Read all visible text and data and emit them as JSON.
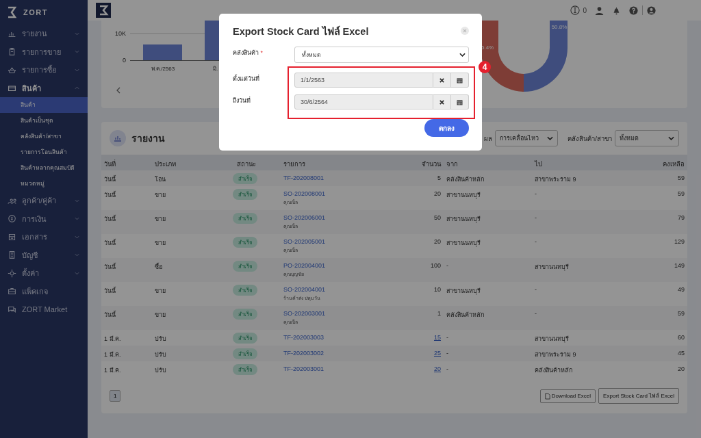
{
  "sidebar": {
    "brand": "ZORT",
    "items": [
      {
        "label": "รายงาน",
        "expanded": false
      },
      {
        "label": "รายการขาย",
        "expanded": false
      },
      {
        "label": "รายการซื้อ",
        "expanded": false
      },
      {
        "label": "สินค้า",
        "expanded": true,
        "children": [
          {
            "label": "สินค้า",
            "selected": true
          },
          {
            "label": "สินค้าเป็นชุด",
            "selected": false
          },
          {
            "label": "คลังสินค้า/สาขา",
            "selected": false
          },
          {
            "label": "รายการโอนสินค้า",
            "selected": false
          },
          {
            "label": "สินค้าหลากคุณสมบัติ",
            "selected": false
          },
          {
            "label": "หมวดหมู่",
            "selected": false
          }
        ]
      },
      {
        "label": "ลูกค้า/คู่ค้า",
        "expanded": false
      },
      {
        "label": "การเงิน",
        "expanded": false
      },
      {
        "label": "เอกสาร",
        "expanded": false
      },
      {
        "label": "บัญชี",
        "expanded": false
      },
      {
        "label": "ตั้งค่า",
        "expanded": false
      },
      {
        "label": "แพ็คเกจ"
      },
      {
        "label": "ZORT Market"
      }
    ]
  },
  "topbar": {
    "count": "0"
  },
  "charts": {
    "bar_ticks": [
      "10K",
      "0"
    ],
    "bar_labels": [
      "พ.ค./2563",
      "มิ."
    ],
    "donut_labels": [
      "50.8%",
      "5.4%"
    ]
  },
  "report": {
    "title": "รายงาน",
    "filters": [
      {
        "label": "ผล",
        "value": "การเคลื่อนไหว"
      },
      {
        "label": "คลังสินค้า/สาขา",
        "value": "ทั้งหมด"
      }
    ],
    "columns": [
      "วันที่",
      "ประเภท",
      "สถานะ",
      "รายการ",
      "จำนวน",
      "จาก",
      "ไป",
      "คงเหลือ"
    ],
    "rows": [
      {
        "date": "วันนี้",
        "type": "โอน",
        "status": "สำเร็จ",
        "ref": "TF-202008001",
        "qty": "5",
        "qty_link": false,
        "from": "คลังสินค้าหลัก",
        "to": "สาขาพระราม 9",
        "balance": "59"
      },
      {
        "date": "วันนี้",
        "type": "ขาย",
        "status": "สำเร็จ",
        "ref": "SO-202008001",
        "sub": "คุณเบ็ล",
        "qty": "20",
        "qty_link": false,
        "from": "สาขานนทบุรี",
        "to": "-",
        "balance": "59"
      },
      {
        "date": "วันนี้",
        "type": "ขาย",
        "status": "สำเร็จ",
        "ref": "SO-202006001",
        "sub": "คุณเบ็ล",
        "qty": "50",
        "qty_link": false,
        "from": "สาขานนทบุรี",
        "to": "-",
        "balance": "79"
      },
      {
        "date": "วันนี้",
        "type": "ขาย",
        "status": "สำเร็จ",
        "ref": "SO-202005001",
        "sub": "คุณเบ็ล",
        "qty": "20",
        "qty_link": false,
        "from": "สาขานนทบุรี",
        "to": "-",
        "balance": "129"
      },
      {
        "date": "วันนี้",
        "type": "ซื้อ",
        "status": "สำเร็จ",
        "ref": "PO-202004001",
        "sub": "คุณบุญชัย",
        "qty": "100",
        "qty_link": false,
        "from": "-",
        "to": "สาขานนทบุรี",
        "balance": "149"
      },
      {
        "date": "วันนี้",
        "type": "ขาย",
        "status": "สำเร็จ",
        "ref": "SO-202004001",
        "sub": "ร้านค้าส่ง ปทุมวัน",
        "qty": "10",
        "qty_link": false,
        "from": "สาขานนทบุรี",
        "to": "-",
        "balance": "49"
      },
      {
        "date": "วันนี้",
        "type": "ขาย",
        "status": "สำเร็จ",
        "ref": "SO-202003001",
        "sub": "คุณเบ็ล",
        "qty": "1",
        "qty_link": false,
        "from": "คลังสินค้าหลัก",
        "to": "-",
        "balance": "59"
      },
      {
        "date": "1 มี.ค.",
        "type": "ปรับ",
        "status": "สำเร็จ",
        "ref": "TF-202003003",
        "qty": "15",
        "qty_link": true,
        "from": "-",
        "to": "สาขานนทบุรี",
        "balance": "60"
      },
      {
        "date": "1 มี.ค.",
        "type": "ปรับ",
        "status": "สำเร็จ",
        "ref": "TF-202003002",
        "qty": "25",
        "qty_link": true,
        "from": "-",
        "to": "สาขาพระราม 9",
        "balance": "45"
      },
      {
        "date": "1 มี.ค.",
        "type": "ปรับ",
        "status": "สำเร็จ",
        "ref": "TF-202003001",
        "qty": "20",
        "qty_link": true,
        "from": "-",
        "to": "คลังสินค้าหลัก",
        "balance": "20"
      }
    ],
    "pages": [
      {
        "label": "1",
        "selected": true
      }
    ],
    "buttons": [
      "Download Excel",
      "Export Stock Card ไฟล์ Excel"
    ]
  },
  "modal": {
    "title": "Export Stock Card ไฟล์ Excel",
    "warehouse": {
      "label": "คลังสินค้า",
      "required_mark": "*",
      "value": "ทั้งหมด"
    },
    "dates": [
      {
        "label": "ตั้งแต่วันที่",
        "value": "1/1/2563"
      },
      {
        "label": "ถึงวันที่",
        "value": "30/6/2564"
      }
    ],
    "callout": "4",
    "submit": "ตกลง"
  }
}
